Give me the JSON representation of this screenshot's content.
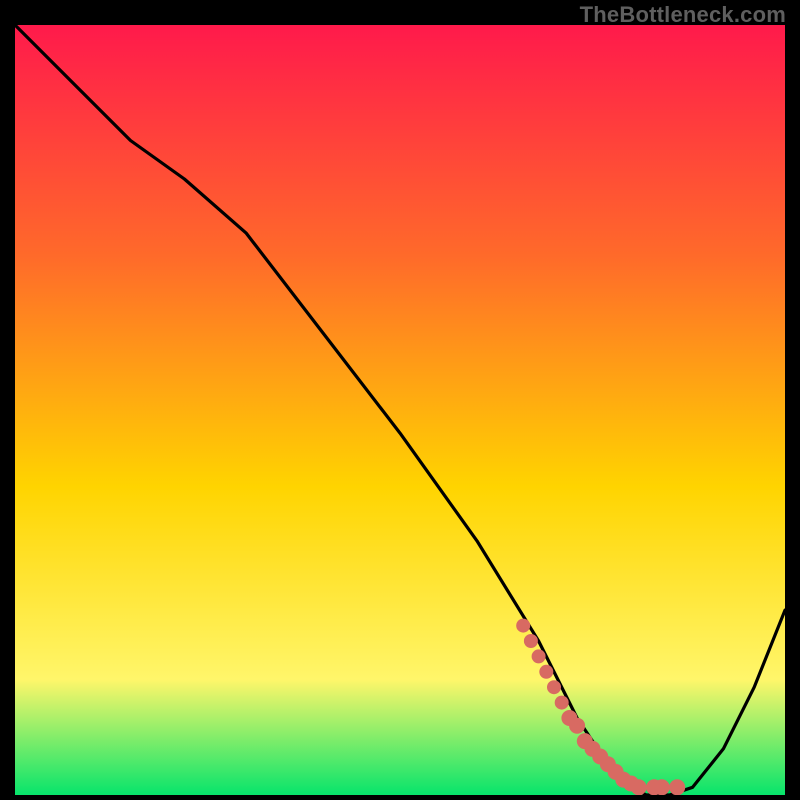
{
  "watermark": "TheBottleneck.com",
  "colors": {
    "gradient_top": "#ff1a4b",
    "gradient_mid1": "#ff6a2a",
    "gradient_mid2": "#ffd400",
    "gradient_mid3": "#fff66a",
    "gradient_bottom": "#07e46b",
    "curve": "#000000",
    "dots": "#d86a62",
    "frame": "#000000"
  },
  "chart_data": {
    "type": "line",
    "title": "",
    "xlabel": "",
    "ylabel": "",
    "xlim": [
      0,
      100
    ],
    "ylim": [
      0,
      100
    ],
    "series": [
      {
        "name": "bottleneck-curve",
        "x": [
          0,
          8,
          15,
          22,
          30,
          40,
          50,
          60,
          68,
          73,
          77,
          80,
          82,
          85,
          88,
          92,
          96,
          100
        ],
        "y": [
          100,
          92,
          85,
          80,
          73,
          60,
          47,
          33,
          20,
          10,
          4,
          1,
          0,
          0,
          1,
          6,
          14,
          24
        ]
      }
    ],
    "scatter_points": {
      "name": "highlight-dots",
      "x": [
        66,
        67,
        68,
        69,
        70,
        71,
        72,
        73,
        74,
        75,
        76,
        77,
        78,
        79,
        80,
        81,
        83,
        84,
        86
      ],
      "y": [
        22,
        20,
        18,
        16,
        14,
        12,
        10,
        9,
        7,
        6,
        5,
        4,
        3,
        2,
        1.5,
        1,
        1,
        1,
        1
      ]
    },
    "grid": false,
    "legend": false
  }
}
